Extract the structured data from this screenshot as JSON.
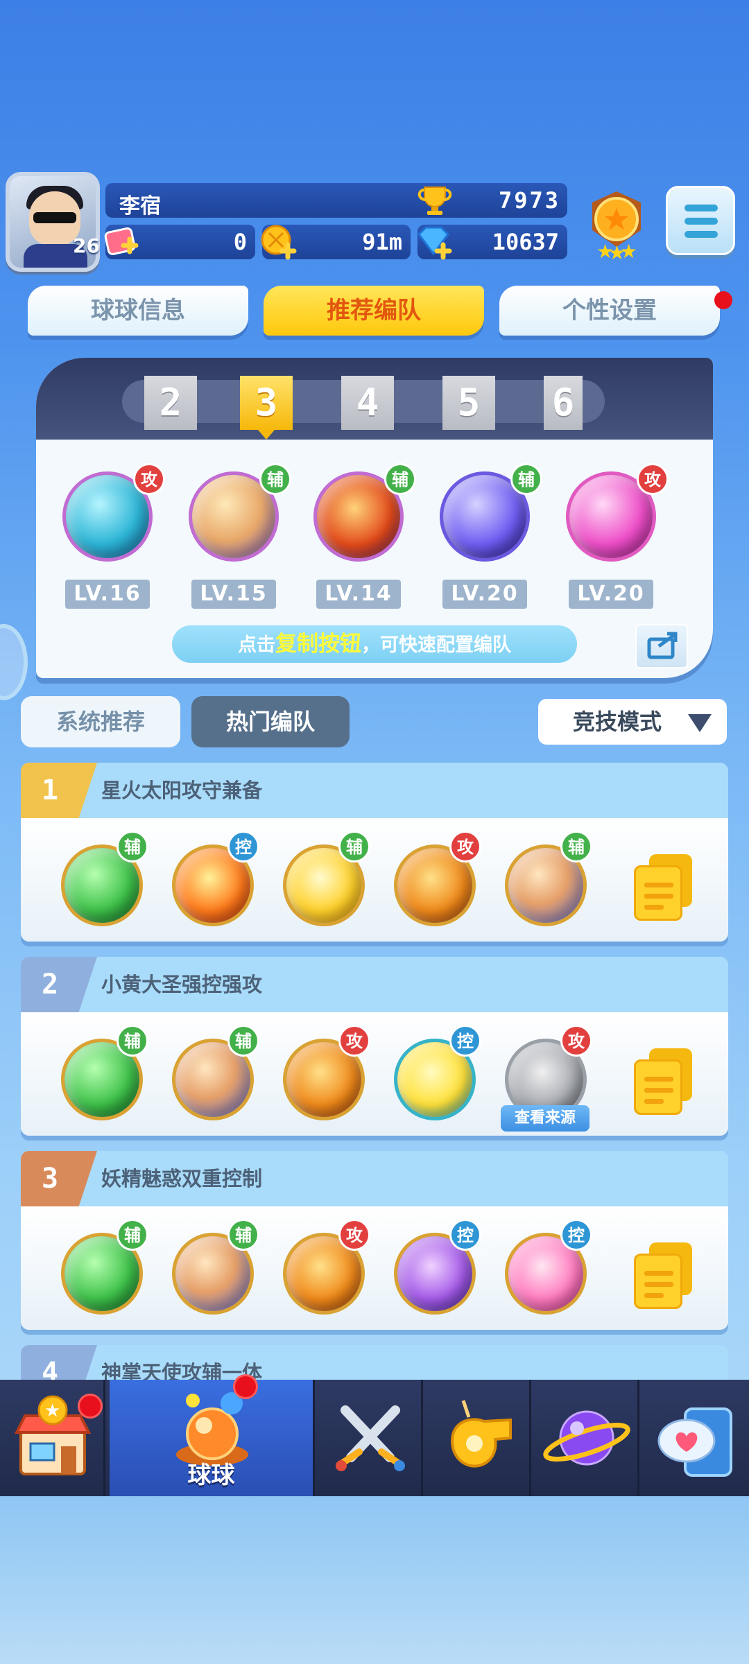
{
  "header": {
    "player_name": "李宿",
    "level": "26",
    "trophy_count": "7973",
    "resources": [
      "0",
      "91m",
      "10637"
    ]
  },
  "top_tabs": [
    "球球信息",
    "推荐编队",
    "个性设置"
  ],
  "formation": {
    "numbers": [
      "2",
      "3",
      "4",
      "5",
      "6"
    ],
    "active_number": "3",
    "heroes": [
      {
        "role": "攻",
        "level": "LV.16"
      },
      {
        "role": "辅",
        "level": "LV.15"
      },
      {
        "role": "辅",
        "level": "LV.14"
      },
      {
        "role": "辅",
        "level": "LV.20"
      },
      {
        "role": "攻",
        "level": "LV.20"
      }
    ],
    "hint_prefix": "点击",
    "hint_highlight": "复制按钮",
    "hint_suffix": "，可快速配置编队"
  },
  "sub_tabs": {
    "system": "系统推荐",
    "hot": "热门编队"
  },
  "mode_select": {
    "value": "竞技模式"
  },
  "teams": [
    {
      "rank": "1",
      "title": "星火太阳攻守兼备",
      "roles": [
        "辅",
        "控",
        "辅",
        "攻",
        "辅"
      ]
    },
    {
      "rank": "2",
      "title": "小黄大圣强控强攻",
      "roles": [
        "辅",
        "辅",
        "攻",
        "控",
        "攻"
      ],
      "view_source": "查看来源"
    },
    {
      "rank": "3",
      "title": "妖精魅惑双重控制",
      "roles": [
        "辅",
        "辅",
        "攻",
        "控",
        "控"
      ]
    },
    {
      "rank": "4",
      "title": "神掌天使攻辅一体"
    }
  ],
  "bottom_nav": {
    "active_label": "球球",
    "items": [
      "shop-icon",
      "ball-icon",
      "battle-swords-icon",
      "whistle-icon",
      "planet-icon",
      "chat-heart-icon"
    ]
  },
  "colors": {
    "attack": "#e2403f",
    "support": "#43b14a",
    "control": "#2f96d6",
    "active_tab": "#ffc80c"
  }
}
